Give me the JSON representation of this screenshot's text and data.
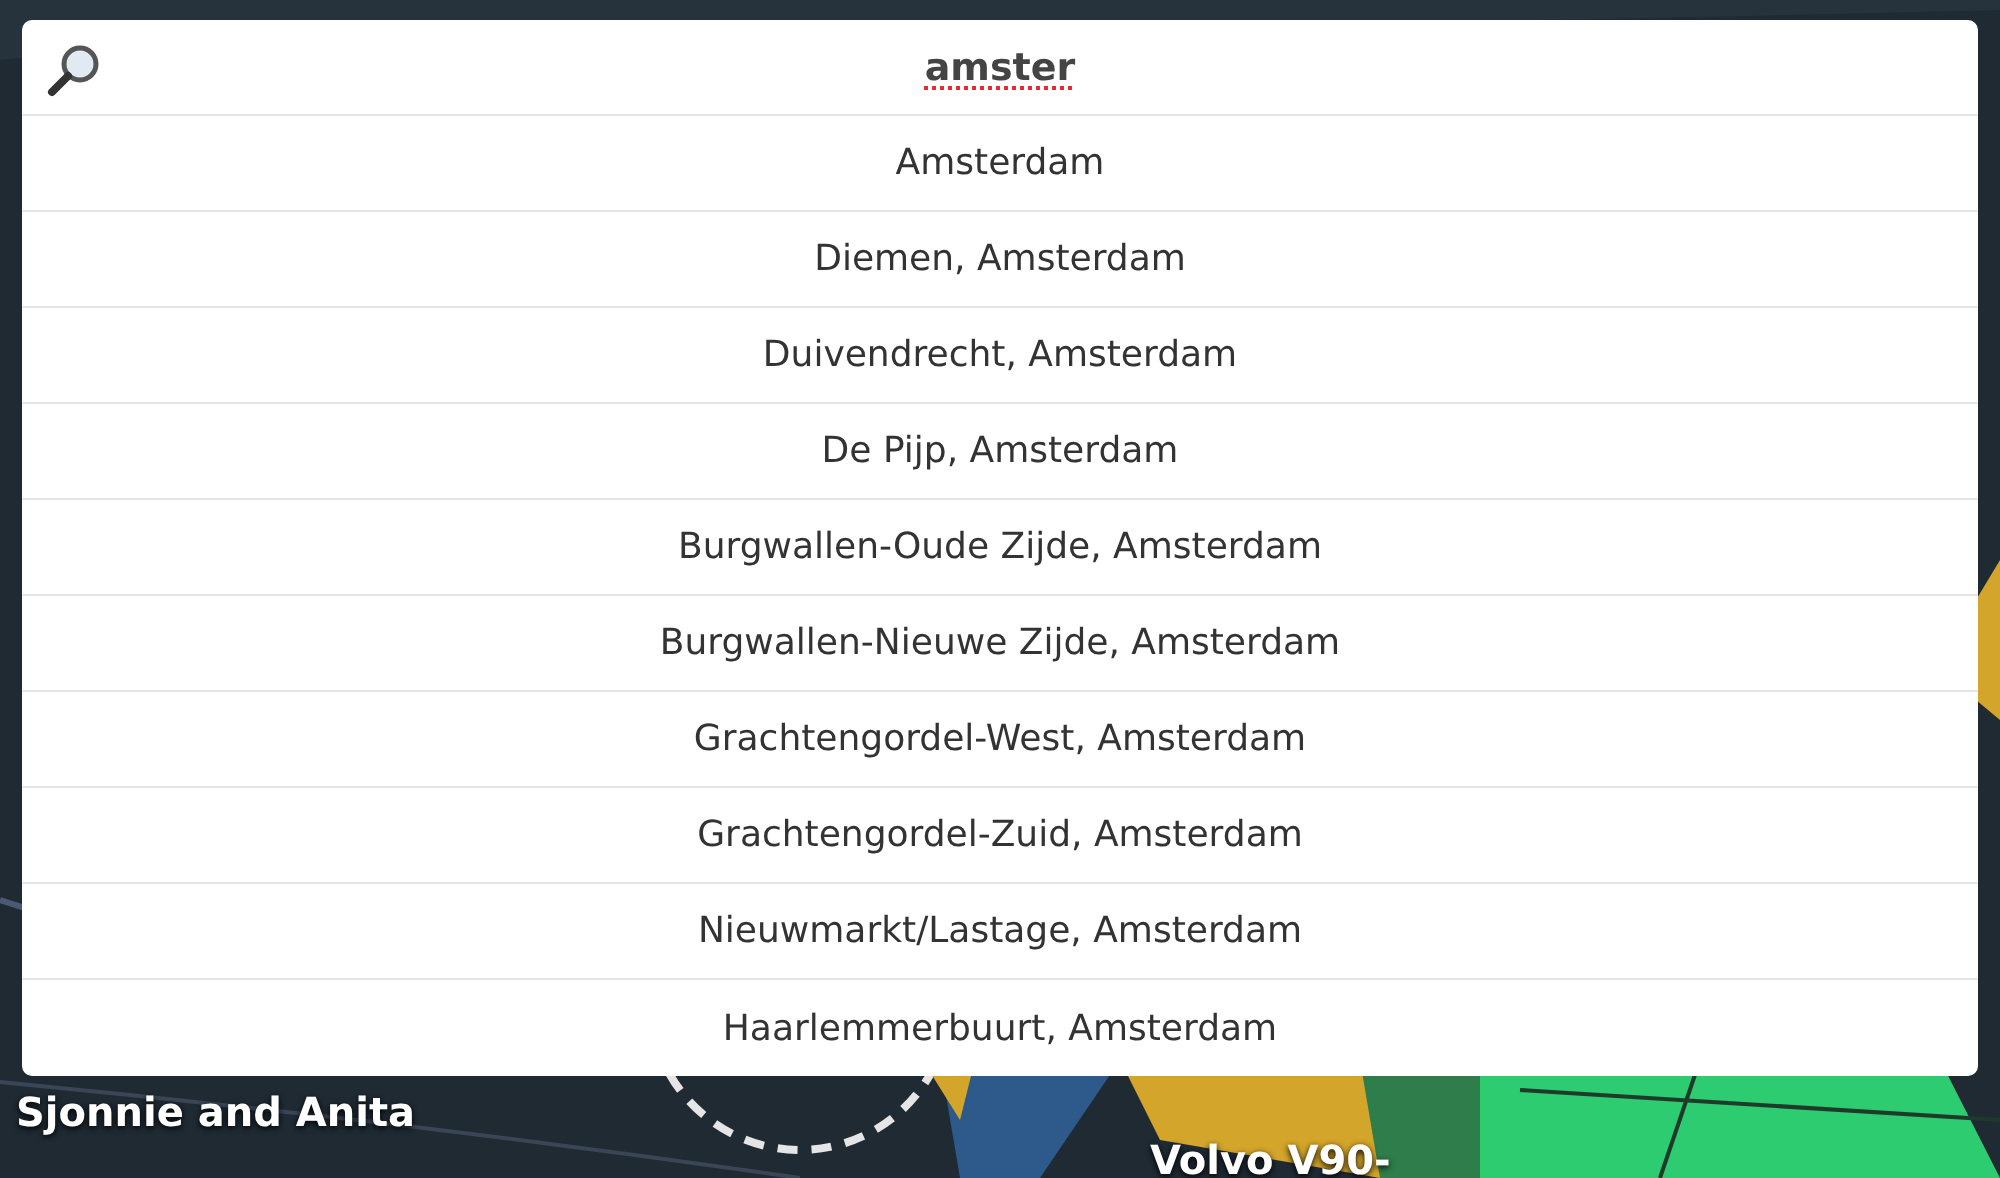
{
  "search": {
    "value": "amster",
    "misspelled": true
  },
  "results": [
    {
      "label": "Amsterdam"
    },
    {
      "label": "Diemen, Amsterdam"
    },
    {
      "label": "Duivendrecht, Amsterdam"
    },
    {
      "label": "De Pijp, Amsterdam"
    },
    {
      "label": "Burgwallen-Oude Zijde, Amsterdam"
    },
    {
      "label": "Burgwallen-Nieuwe Zijde, Amsterdam"
    },
    {
      "label": "Grachtengordel-West, Amsterdam"
    },
    {
      "label": "Grachtengordel-Zuid, Amsterdam"
    },
    {
      "label": "Nieuwmarkt/Lastage, Amsterdam"
    },
    {
      "label": "Haarlemmerbuurt, Amsterdam"
    }
  ],
  "map_labels": [
    {
      "text": "Sjonnie and Anita"
    },
    {
      "text": "Volvo V90-"
    }
  ]
}
